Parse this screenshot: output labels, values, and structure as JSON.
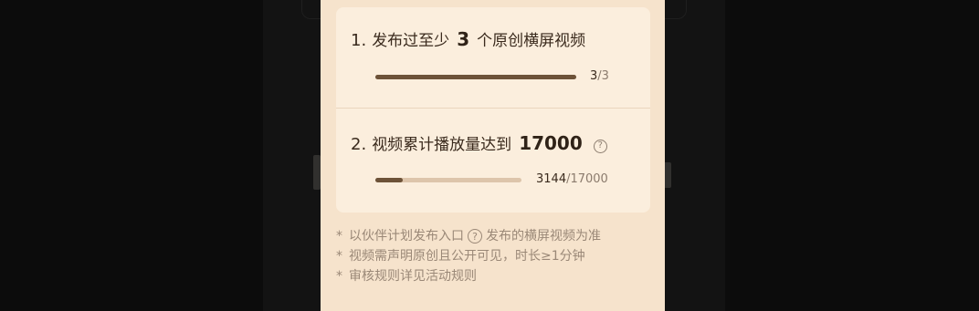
{
  "task1": {
    "index": "1.",
    "prefix": "发布过至少",
    "target": "3",
    "suffix": "个原创横屏视频",
    "progress_current": "3",
    "progress_total": "/3",
    "progress_fraction": 1.0
  },
  "task2": {
    "index": "2.",
    "prefix": "视频累计播放量达到",
    "target": "17000",
    "help_icon": "question-circle-icon",
    "progress_current": "3144",
    "progress_total": "/17000",
    "progress_fraction": 0.185
  },
  "notes": [
    {
      "star": "*",
      "before": "以伙伴计划发布入口",
      "icon": "question-circle-icon",
      "after": "发布的横屏视频为准"
    },
    {
      "star": "*",
      "text": "视频需声明原创且公开可见，时长≥1分钟"
    },
    {
      "star": "*",
      "text": "审核规则详见活动规则"
    }
  ],
  "colors": {
    "panel": "#f6e3cc",
    "card": "#fbeedd",
    "progress_fill": "#6d5238",
    "progress_track": "#ddc5ab"
  }
}
